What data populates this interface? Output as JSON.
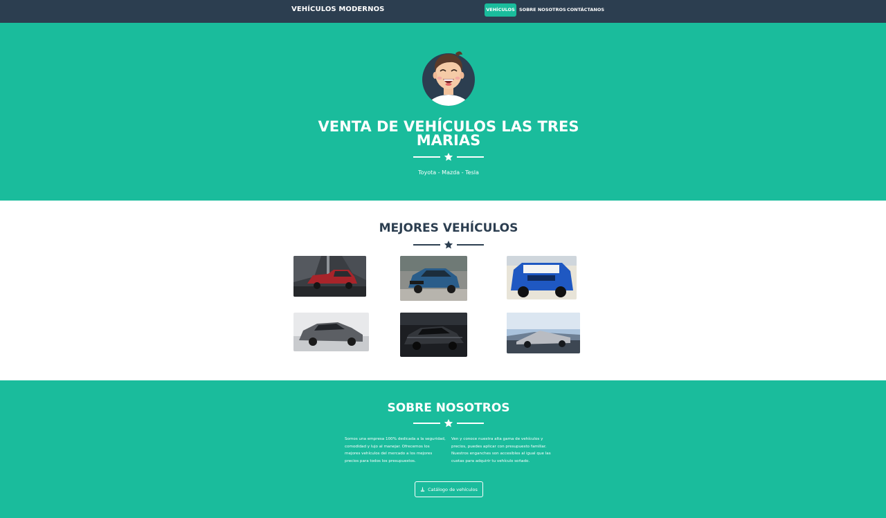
{
  "navbar": {
    "brand": "VEHÍCULOS MODERNOS",
    "links": [
      {
        "label": "VEHÍCULOS",
        "active": true
      },
      {
        "label": "SOBRE NOSOTROS",
        "active": false
      },
      {
        "label": "CONTÁCTANOS",
        "active": false
      }
    ]
  },
  "hero": {
    "title": "VENTA DE VEHÍCULOS LAS TRES MARIAS",
    "subtitle": "Toyota - Mazda - Tesla",
    "divider_icon": "star-icon"
  },
  "portfolio": {
    "title": "MEJORES VEHÍCULOS",
    "divider_icon": "star-icon",
    "cars": [
      {
        "name": "red-pickup",
        "color": "#a8242a"
      },
      {
        "name": "blue-suv",
        "color": "#2a5d8a"
      },
      {
        "name": "blue-offroad",
        "color": "#1f58c2"
      },
      {
        "name": "grey-crossover",
        "color": "#5c5f64"
      },
      {
        "name": "dark-sedan",
        "color": "#33363b"
      },
      {
        "name": "silver-truck",
        "color": "#b9bcc2"
      }
    ]
  },
  "about": {
    "title": "SOBRE NOSOTROS",
    "divider_icon": "star-icon",
    "text_left": "Somos una empresa 100% dedicada a la seguridad, comodidad y lujo al manejar. Ofrecemos los mejores vehículos del mercado a los mejores precios para todos los presupuestos.",
    "text_right": "Ven y conoce nuestra alta gama de vehículos y precios, puedes aplicar con presupuesto familiar. Nuestros enganches son accesibles al igual que las cuotas para adquirir tu vehículo soñado.",
    "button_label": "Catálogo de vehículos",
    "button_icon": "download-icon"
  },
  "colors": {
    "primary": "#2c3e50",
    "accent": "#1abc9c",
    "white": "#ffffff"
  }
}
